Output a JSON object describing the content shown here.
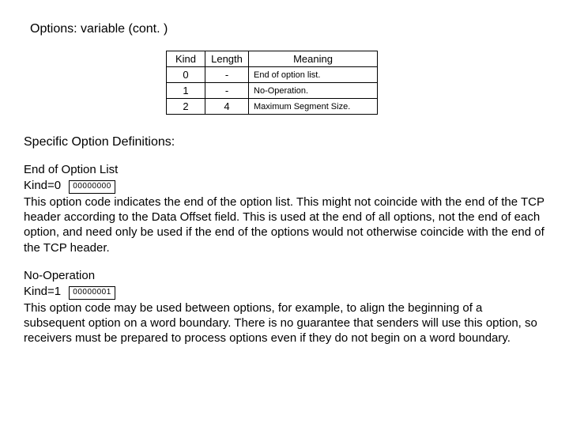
{
  "title": "Options: variable (cont. )",
  "table": {
    "headers": [
      "Kind",
      "Length",
      "Meaning"
    ],
    "rows": [
      {
        "kind": "0",
        "length": "-",
        "meaning": "End of option list."
      },
      {
        "kind": "1",
        "length": "-",
        "meaning": "No-Operation."
      },
      {
        "kind": "2",
        "length": "4",
        "meaning": "Maximum Segment Size."
      }
    ]
  },
  "subhead": "Specific Option Definitions:",
  "options": [
    {
      "name": "End of Option List",
      "kind_label": "Kind=0",
      "bits": "00000000",
      "desc": "This option code indicates the end of the option list. This might not coincide with the end of the TCP header according to the Data Offset field. This is used at the end of all options, not the end of each option, and need only be used if the end of the options would not otherwise coincide with the end of the TCP header."
    },
    {
      "name": "No-Operation",
      "kind_label": "Kind=1",
      "bits": "00000001",
      "desc": "This option code may be used between options, for example, to align the beginning of a subsequent option on a word boundary. There is no guarantee that senders will use this option, so receivers must be prepared to process options even if they do not begin on a word boundary."
    }
  ],
  "chart_data": {
    "type": "table",
    "title": "Options: variable (cont.)",
    "columns": [
      "Kind",
      "Length",
      "Meaning"
    ],
    "rows": [
      [
        0,
        "-",
        "End of option list."
      ],
      [
        1,
        "-",
        "No-Operation."
      ],
      [
        2,
        4,
        "Maximum Segment Size."
      ]
    ]
  }
}
